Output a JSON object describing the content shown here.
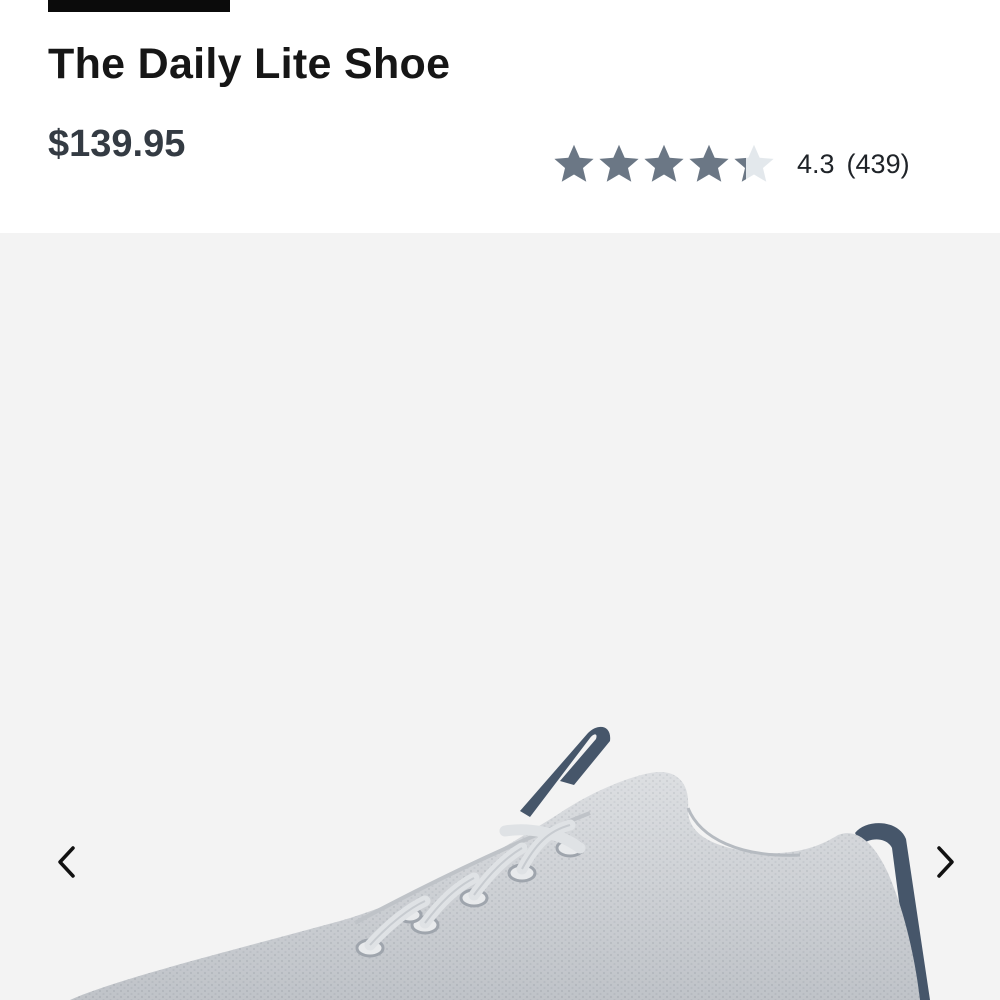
{
  "product": {
    "title": "The Daily Lite Shoe",
    "price": "$139.95"
  },
  "rating": {
    "value": "4.3",
    "stars_filled": 4.3,
    "stars_max": 5,
    "review_count": "(439)",
    "star_color": "#6b7785",
    "star_empty_color": "#e3e8ec"
  },
  "gallery": {
    "image_description_icon": "shoe-image",
    "prev_icon": "chevron-left-icon",
    "next_icon": "chevron-right-icon"
  },
  "colors": {
    "title": "#161616",
    "price": "#343b43",
    "gallery_bg": "#f3f3f3",
    "badge": "#0b0b0b"
  }
}
